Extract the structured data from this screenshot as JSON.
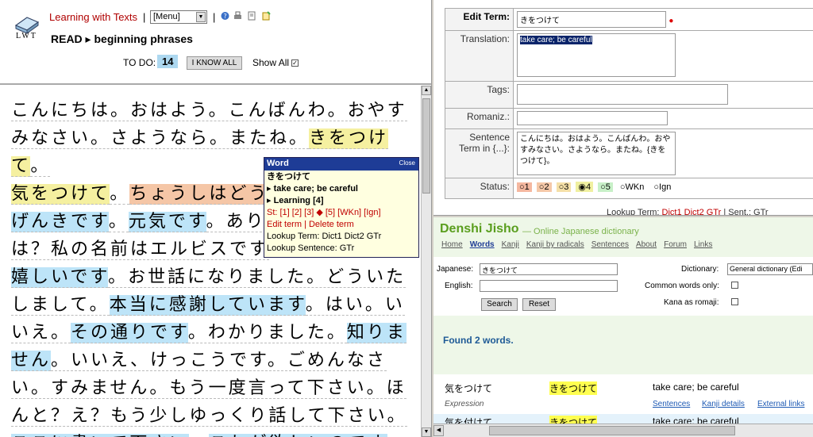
{
  "header": {
    "logo_text": "LWT",
    "app_title": "Learning with Texts",
    "menu_select": "[Menu]",
    "read_prefix": "READ",
    "text_title": "beginning phrases",
    "todo_label": "TO DO:",
    "todo_count": "14",
    "iknow_label": "I KNOW ALL",
    "showall_label": "Show All"
  },
  "reading": {
    "lines": [
      [
        {
          "t": "こんにちは。おはよう。こんばんわ。おやす",
          "c": ""
        }
      ],
      [
        {
          "t": "みなさい。さようなら。またね。",
          "c": ""
        },
        {
          "t": "きをつけ",
          "c": "yellow"
        }
      ],
      [
        {
          "t": "て",
          "c": "yellow"
        },
        {
          "t": "。",
          "c": ""
        }
      ],
      [
        {
          "t": "気をつけて",
          "c": "yellow"
        },
        {
          "t": "。",
          "c": ""
        },
        {
          "t": "ちょうしはどう",
          "c": "orange"
        }
      ],
      [
        {
          "t": "げんきです",
          "c": "blue"
        },
        {
          "t": "。",
          "c": ""
        },
        {
          "t": "元気です",
          "c": "blue"
        },
        {
          "t": "。あり",
          "c": ""
        }
      ],
      [
        {
          "t": "は？私の名前はエルビスです",
          "c": ""
        }
      ],
      [
        {
          "t": "嬉しいです",
          "c": "blue"
        },
        {
          "t": "。お世話になりました。どういた",
          "c": ""
        }
      ],
      [
        {
          "t": "しまして。",
          "c": ""
        },
        {
          "t": "本当に感謝しています",
          "c": "blue"
        },
        {
          "t": "。はい。い",
          "c": ""
        }
      ],
      [
        {
          "t": "いえ。",
          "c": ""
        },
        {
          "t": "その通りです",
          "c": "blue"
        },
        {
          "t": "。わかりました。",
          "c": ""
        },
        {
          "t": "知りま",
          "c": "blue"
        }
      ],
      [
        {
          "t": "せん",
          "c": "blue"
        },
        {
          "t": "。いいえ、けっこうです。ごめんなさ",
          "c": ""
        }
      ],
      [
        {
          "t": "い。すみません。もう一度言って下さい。ほ",
          "c": ""
        }
      ],
      [
        {
          "t": "んと？え？もう少しゆっくり話して下さい。",
          "c": ""
        }
      ],
      [
        {
          "t": "ここに書いて下さい",
          "c": "blue"
        },
        {
          "t": "。",
          "c": ""
        },
        {
          "t": "これが欲しいのです",
          "c": "blue"
        }
      ]
    ]
  },
  "popup": {
    "title": "Word",
    "close": "Close",
    "term": "きをつけて",
    "translation": "▸ take care; be careful",
    "status": "▸ Learning [4]",
    "status_line": "St: [1] [2] [3] ◆ [5] [WKn] [Ign]",
    "edit_links": "Edit term | Delete term",
    "lookup_term": "Lookup Term: Dict1 Dict2 GTr",
    "lookup_sentence": "Lookup Sentence: GTr"
  },
  "edit_form": {
    "edit_term_label": "Edit Term:",
    "edit_term_value": "きをつけて",
    "translation_label": "Translation:",
    "translation_value": "take care; be careful",
    "tags_label": "Tags:",
    "romaniz_label": "Romaniz.:",
    "sentence_label": "Sentence Term in {...}:",
    "sentence_value": "こんにちは。おはよう。こんばんわ。おやすみなさい。さようなら。またね。{きをつけて}。",
    "status_label": "Status:",
    "status_options": [
      "1",
      "2",
      "3",
      "4",
      "5",
      "WKn",
      "Ign"
    ],
    "lookup_prefix": "Lookup Term:",
    "lookup_links": "Dict1 Dict2 GTr",
    "lookup_sent": "| Sent.: GTr"
  },
  "jisho": {
    "title": "Denshi Jisho",
    "subtitle": "— Online Japanese dictionary",
    "nav": [
      "Home",
      "Words",
      "Kanji",
      "Kanji by radicals",
      "Sentences",
      "About",
      "Forum",
      "Links"
    ],
    "japanese_label": "Japanese:",
    "japanese_value": "きをつけて",
    "english_label": "English:",
    "dictionary_label": "Dictionary:",
    "dictionary_value": "General dictionary (Edi",
    "common_label": "Common words only:",
    "kana_label": "Kana as romaji:",
    "search_btn": "Search",
    "reset_btn": "Reset",
    "found_text": "Found 2 words.",
    "results": [
      {
        "kanji": "気をつけて",
        "kana": "きをつけて",
        "meaning": "take care; be careful"
      },
      {
        "kanji": "気を付けて",
        "kana": "きをつけて",
        "meaning": "take care; be careful"
      }
    ],
    "expression_label": "Expression",
    "links": [
      "Sentences",
      "Kanji details",
      "External links"
    ]
  }
}
